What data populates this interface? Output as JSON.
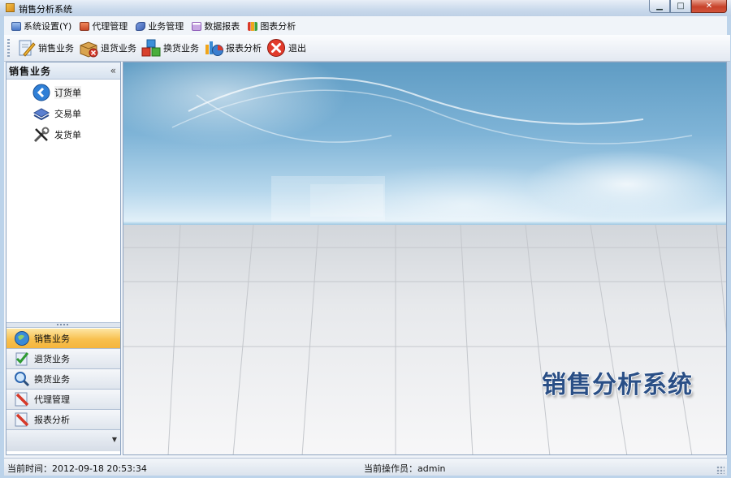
{
  "window": {
    "title": "销售分析系统"
  },
  "menu": [
    {
      "label": "系统设置(Y)",
      "icon": "computer-icon",
      "color": "#4a78c8"
    },
    {
      "label": "代理管理",
      "icon": "folder-icon",
      "color": "#c94a2a"
    },
    {
      "label": "业务管理",
      "icon": "checkmark-icon",
      "color": "#3b5fb3"
    },
    {
      "label": "数据报表",
      "icon": "calendar-icon",
      "color": "#8c57b6"
    },
    {
      "label": "图表分析",
      "icon": "bar-chart-icon",
      "color": "#e08a14"
    }
  ],
  "toolbar": [
    {
      "label": "销售业务",
      "icon": "pencil-doc-icon"
    },
    {
      "label": "退货业务",
      "icon": "box-return-icon"
    },
    {
      "label": "换货业务",
      "icon": "cubes-icon"
    },
    {
      "label": "报表分析",
      "icon": "chart-icon"
    },
    {
      "label": "退出",
      "icon": "exit-icon"
    }
  ],
  "left_panel": {
    "title": "销售业务",
    "collapse_glyph": "«",
    "tree": [
      {
        "label": "订货单",
        "icon": "order-icon",
        "selected": true
      },
      {
        "label": "交易单",
        "icon": "trade-icon",
        "selected": false
      },
      {
        "label": "发货单",
        "icon": "tools-icon",
        "selected": false
      }
    ],
    "nav": [
      {
        "label": "销售业务",
        "icon": "globe-icon",
        "active": true
      },
      {
        "label": "退货业务",
        "icon": "check-doc-icon",
        "active": false
      },
      {
        "label": "换货业务",
        "icon": "magnifier-icon",
        "active": false
      },
      {
        "label": "代理管理",
        "icon": "pencil-icon",
        "active": false
      },
      {
        "label": "报表分析",
        "icon": "pencil-icon",
        "active": false
      }
    ]
  },
  "main": {
    "brand_text": "销售分析系统"
  },
  "status": {
    "time": "当前时间：2012-09-18 20:53:34",
    "operator": "当前操作员：admin"
  },
  "colors": {
    "accent": "#f8c04e",
    "brand": "#2a4f86"
  }
}
